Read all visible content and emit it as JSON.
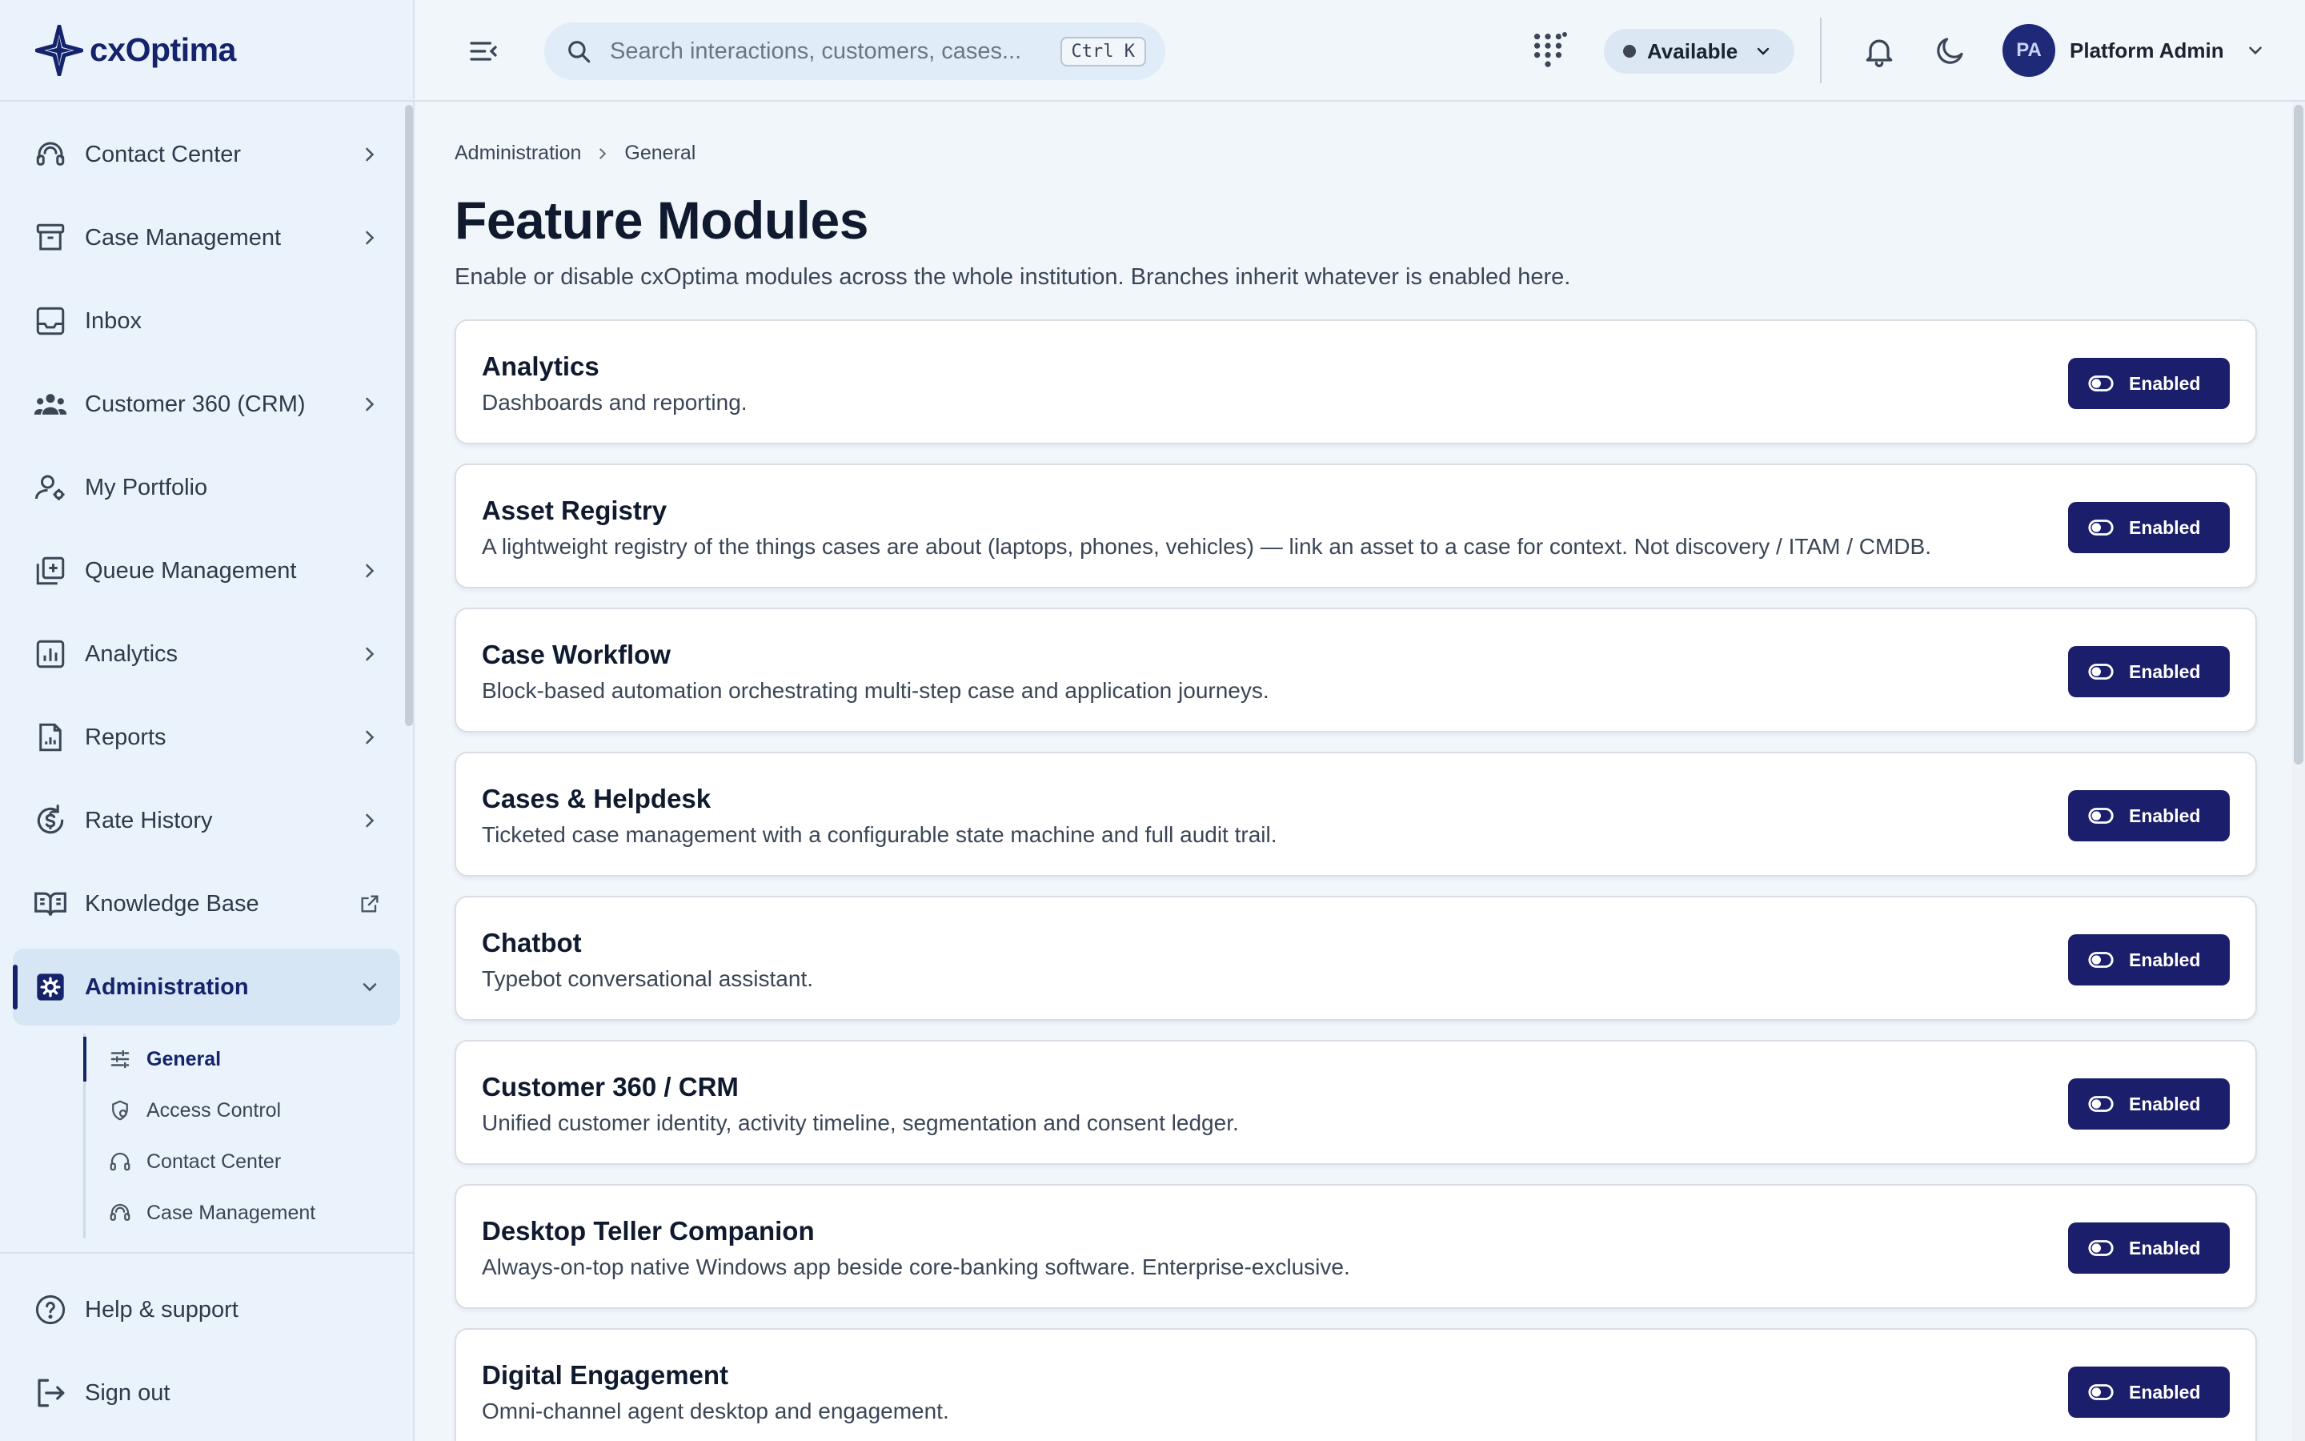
{
  "app": {
    "name": "cxOptima"
  },
  "sidebar": {
    "items": [
      {
        "label": "Contact Center",
        "icon": "headset-icon",
        "has_chevron": true
      },
      {
        "label": "Case Management",
        "icon": "archive-box-icon",
        "has_chevron": true
      },
      {
        "label": "Inbox",
        "icon": "inbox-icon",
        "has_chevron": false
      },
      {
        "label": "Customer 360 (CRM)",
        "icon": "users-group-icon",
        "has_chevron": true
      },
      {
        "label": "My Portfolio",
        "icon": "user-settings-icon",
        "has_chevron": false
      },
      {
        "label": "Queue Management",
        "icon": "queue-add-icon",
        "has_chevron": true
      },
      {
        "label": "Analytics",
        "icon": "bar-chart-icon",
        "has_chevron": true
      },
      {
        "label": "Reports",
        "icon": "report-document-icon",
        "has_chevron": true
      },
      {
        "label": "Rate History",
        "icon": "currency-history-icon",
        "has_chevron": true
      },
      {
        "label": "Knowledge Base",
        "icon": "book-open-icon",
        "external": true
      },
      {
        "label": "Administration",
        "icon": "gear-icon",
        "expanded": true,
        "active": true
      }
    ],
    "admin_sub": [
      {
        "label": "General",
        "icon": "sliders-icon",
        "active": true
      },
      {
        "label": "Access Control",
        "icon": "shield-icon"
      },
      {
        "label": "Contact Center",
        "icon": "headset-icon"
      },
      {
        "label": "Case Management",
        "icon": "headset-alt-icon"
      }
    ],
    "footer": [
      {
        "label": "Help & support",
        "icon": "help-circle-icon"
      },
      {
        "label": "Sign out",
        "icon": "sign-out-icon"
      }
    ]
  },
  "topbar": {
    "search_placeholder": "Search interactions, customers, cases...",
    "search_shortcut": "Ctrl K",
    "status": "Available",
    "user_initials": "PA",
    "user_name": "Platform Admin"
  },
  "page": {
    "breadcrumb": [
      "Administration",
      "General"
    ],
    "title": "Feature Modules",
    "subtitle": "Enable or disable cxOptima modules across the whole institution. Branches inherit whatever is enabled here."
  },
  "modules": [
    {
      "name": "Analytics",
      "description": "Dashboards and reporting.",
      "status": "Enabled"
    },
    {
      "name": "Asset Registry",
      "description": "A lightweight registry of the things cases are about (laptops, phones, vehicles) — link an asset to a case for context. Not discovery / ITAM / CMDB.",
      "status": "Enabled"
    },
    {
      "name": "Case Workflow",
      "description": "Block-based automation orchestrating multi-step case and application journeys.",
      "status": "Enabled"
    },
    {
      "name": "Cases & Helpdesk",
      "description": "Ticketed case management with a configurable state machine and full audit trail.",
      "status": "Enabled"
    },
    {
      "name": "Chatbot",
      "description": "Typebot conversational assistant.",
      "status": "Enabled"
    },
    {
      "name": "Customer 360 / CRM",
      "description": "Unified customer identity, activity timeline, segmentation and consent ledger.",
      "status": "Enabled"
    },
    {
      "name": "Desktop Teller Companion",
      "description": "Always-on-top native Windows app beside core-banking software. Enterprise-exclusive.",
      "status": "Enabled"
    },
    {
      "name": "Digital Engagement",
      "description": "Omni-channel agent desktop and engagement.",
      "status": "Enabled"
    }
  ],
  "colors": {
    "brand": "#14236b",
    "toggle_bg": "#1b1f6b",
    "sidebar_bg": "#eaf3fb",
    "page_bg": "#f1f6fb"
  }
}
